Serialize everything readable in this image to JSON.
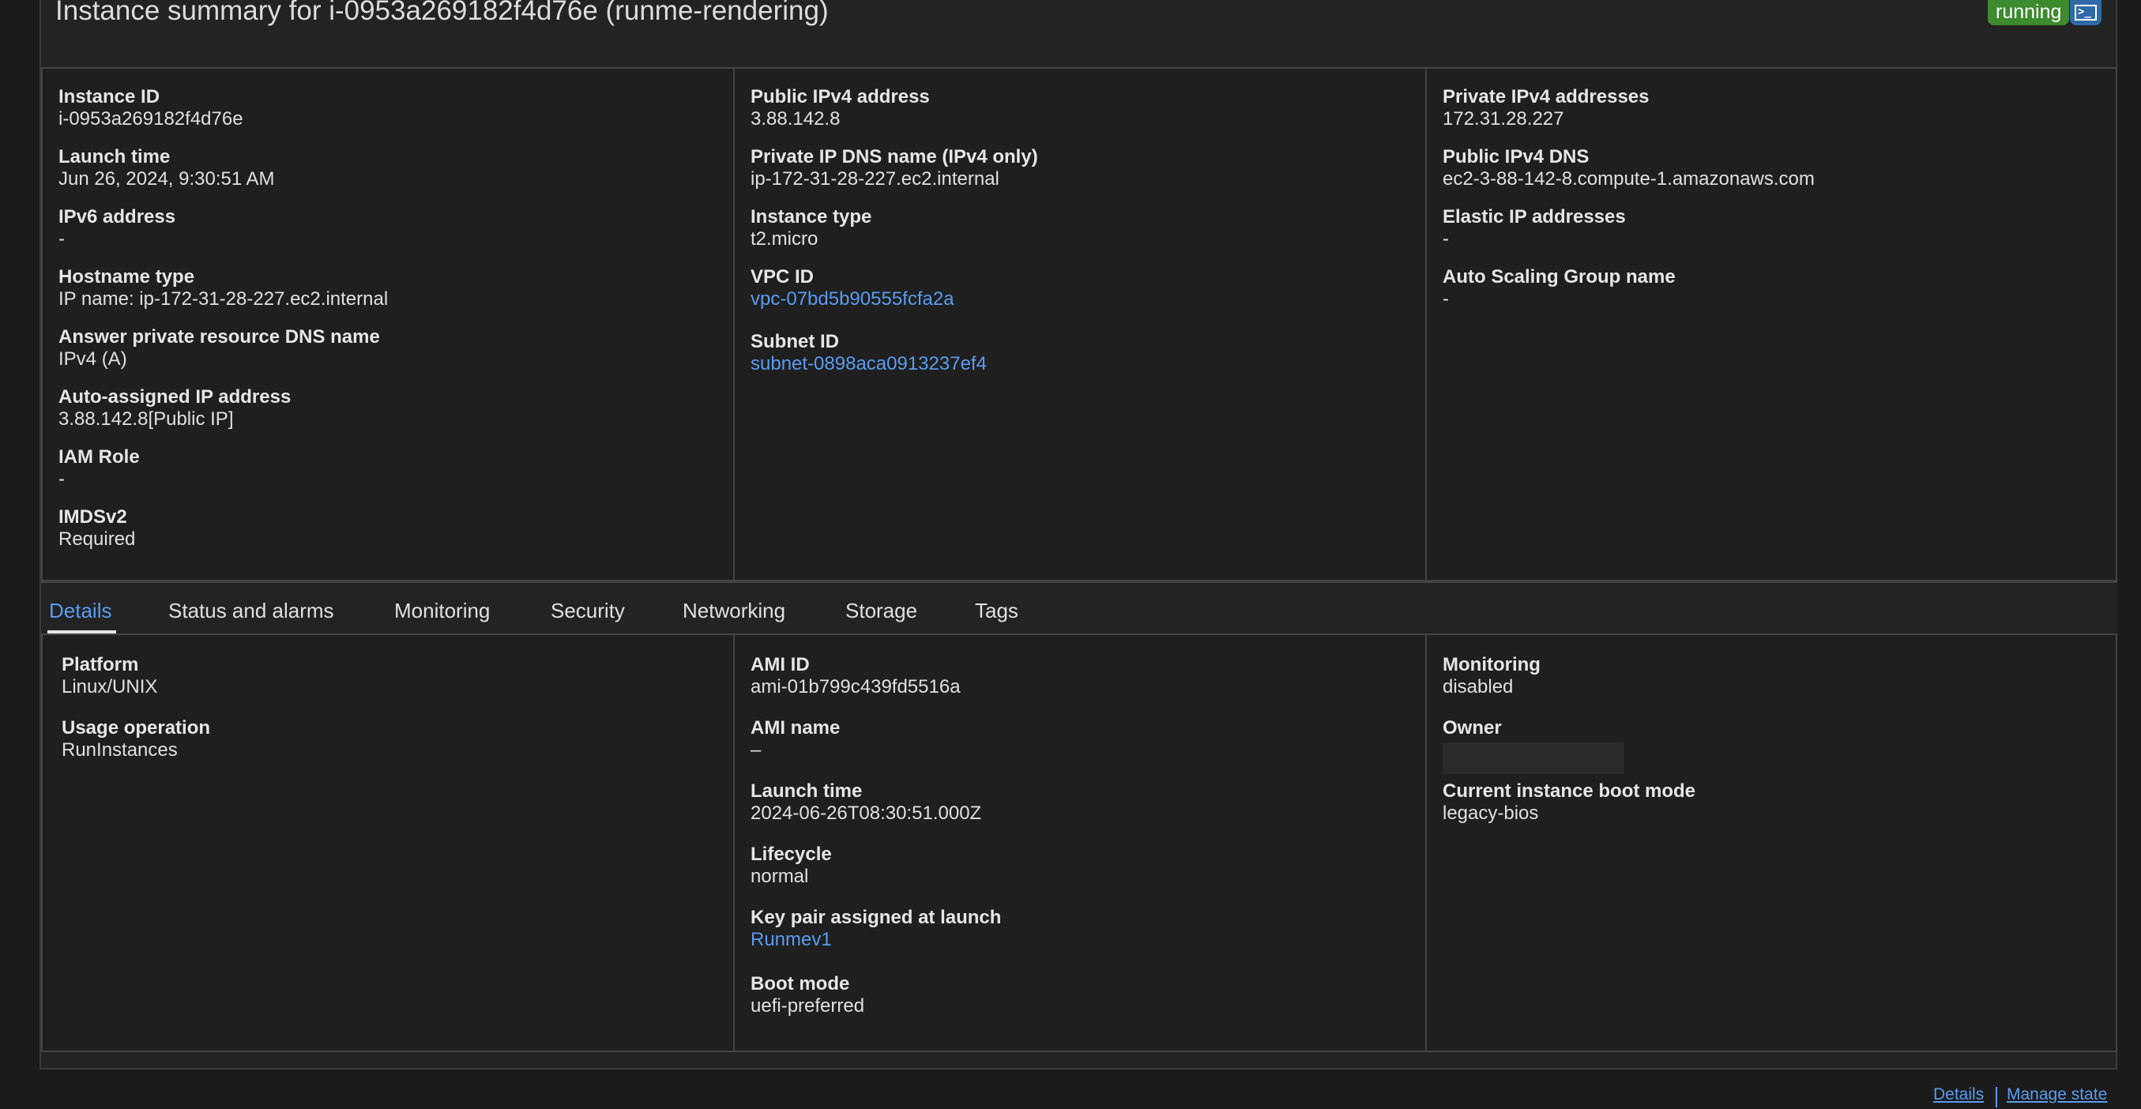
{
  "header": {
    "title": "Instance summary for i-0953a269182f4d76e (runme-rendering)",
    "status": "running",
    "status_color": "#3d8a2f",
    "terminal_icon": "terminal-icon"
  },
  "summary": {
    "col1": [
      {
        "label": "Instance ID",
        "value": "i-0953a269182f4d76e"
      },
      {
        "label": "Launch time",
        "value": "Jun 26, 2024, 9:30:51 AM"
      },
      {
        "label": "IPv6 address",
        "value": "-"
      },
      {
        "label": "Hostname type",
        "value": "IP name: ip-172-31-28-227.ec2.internal"
      },
      {
        "label": "Answer private resource DNS name",
        "value": "IPv4 (A)"
      },
      {
        "label": "Auto-assigned IP address",
        "value": "3.88.142.8[Public IP]"
      },
      {
        "label": "IAM Role",
        "value": "-"
      },
      {
        "label": "IMDSv2",
        "value": "Required"
      }
    ],
    "col2": [
      {
        "label": "Public IPv4 address",
        "value": "3.88.142.8"
      },
      {
        "label": "Private IP DNS name (IPv4 only)",
        "value": "ip-172-31-28-227.ec2.internal"
      },
      {
        "label": "Instance type",
        "value": "t2.micro"
      },
      {
        "label": "VPC ID",
        "value": "vpc-07bd5b90555fcfa2a"
      },
      {
        "label": "Subnet ID",
        "value": "subnet-0898aca0913237ef4"
      }
    ],
    "col3": [
      {
        "label": "Private IPv4 addresses",
        "value": "172.31.28.227"
      },
      {
        "label": "Public IPv4 DNS",
        "value": "ec2-3-88-142-8.compute-1.amazonaws.com"
      },
      {
        "label": "Elastic IP addresses",
        "value": "-"
      },
      {
        "label": "Auto Scaling Group name",
        "value": "-"
      }
    ]
  },
  "tabs": [
    "Details",
    "Status and alarms",
    "Monitoring",
    "Security",
    "Networking",
    "Storage",
    "Tags"
  ],
  "details": {
    "col1": [
      {
        "label": "Platform",
        "value": "Linux/UNIX"
      },
      {
        "label": "Usage operation",
        "value": "RunInstances"
      }
    ],
    "col2": [
      {
        "label": "AMI ID",
        "value": "ami-01b799c439fd5516a"
      },
      {
        "label": "AMI name",
        "value": "–"
      },
      {
        "label": "Launch time",
        "value": "2024-06-26T08:30:51.000Z"
      },
      {
        "label": "Lifecycle",
        "value": "normal"
      },
      {
        "label": "Key pair assigned at launch",
        "value": "Runmev1"
      },
      {
        "label": "Boot mode",
        "value": "uefi-preferred"
      }
    ],
    "col3": [
      {
        "label": "Monitoring",
        "value": "disabled"
      },
      {
        "label": "Owner"
      },
      {
        "label": "Current instance boot mode",
        "value": "legacy-bios"
      }
    ]
  },
  "footer": {
    "details": "Details",
    "manage_state": "Manage state"
  },
  "link_color": "#5a9cf0"
}
